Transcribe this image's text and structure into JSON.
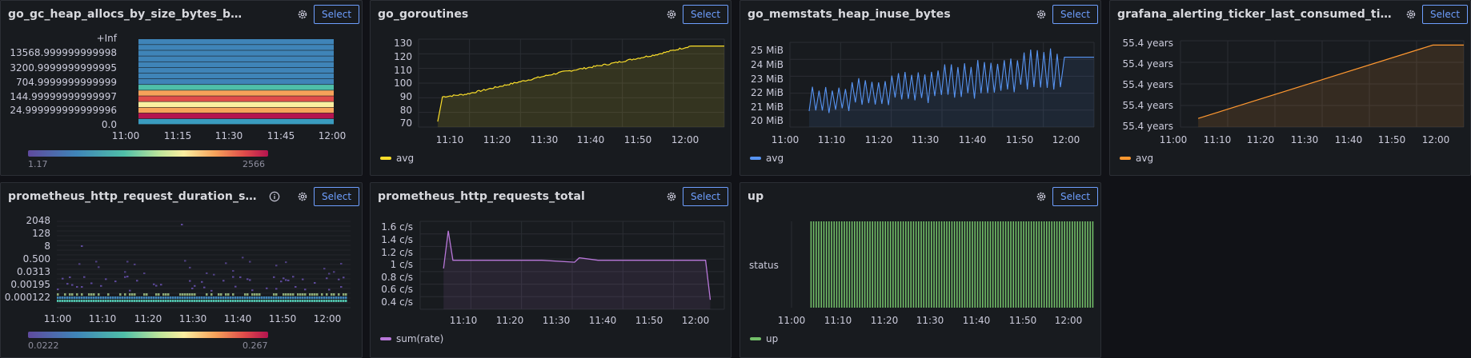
{
  "select_label": "Select",
  "x_ticks": [
    "11:00",
    "11:10",
    "11:20",
    "11:30",
    "11:40",
    "11:50",
    "12:00"
  ],
  "x_ticks_heap": [
    "11:00",
    "11:15",
    "11:30",
    "11:45",
    "12:00"
  ],
  "panels": {
    "heap_allocs": {
      "title": "go_gc_heap_allocs_by_size_bytes_bucket",
      "y_ticks": [
        "+Inf",
        "13568.999999999998",
        "3200.9999999999995",
        "704.9999999999999",
        "144.99999999999997",
        "24.999999999999996",
        "0.0"
      ],
      "scale_min": "1.17",
      "scale_max": "2566"
    },
    "goroutines": {
      "title": "go_goroutines",
      "y_ticks": [
        "130",
        "120",
        "110",
        "100",
        "90",
        "80",
        "70"
      ],
      "legend": "avg",
      "color": "#fade2a"
    },
    "memstats": {
      "title": "go_memstats_heap_inuse_bytes",
      "y_ticks": [
        "25 MiB",
        "24 MiB",
        "23 MiB",
        "22 MiB",
        "21 MiB",
        "20 MiB"
      ],
      "legend": "avg",
      "color": "#5794f2"
    },
    "ticker": {
      "title": "grafana_alerting_ticker_last_consumed_tick_t...",
      "y_ticks": [
        "55.4 years",
        "55.4 years",
        "55.4 years",
        "55.4 years",
        "55.4 years"
      ],
      "legend": "avg",
      "color": "#ff9830"
    },
    "duration": {
      "title": "prometheus_http_request_duration_seco...",
      "y_ticks": [
        "2048",
        "128",
        "8",
        "0.500",
        "0.0313",
        "0.00195",
        "0.000122"
      ],
      "scale_min": "0.0222",
      "scale_max": "0.267"
    },
    "requests": {
      "title": "prometheus_http_requests_total",
      "y_ticks": [
        "1.6 c/s",
        "1.4 c/s",
        "1.2 c/s",
        "1 c/s",
        "0.8 c/s",
        "0.6 c/s",
        "0.4 c/s"
      ],
      "legend": "sum(rate)",
      "color": "#b877d9"
    },
    "up": {
      "title": "up",
      "y_label": "status",
      "legend": "up",
      "color": "#73bf69"
    }
  },
  "chart_data": [
    {
      "type": "heatmap",
      "title": "go_gc_heap_allocs_by_size_bytes_bucket",
      "x": [
        "11:00",
        "11:15",
        "11:30",
        "11:45",
        "12:00"
      ],
      "y_buckets": [
        "0.0",
        "24.999999999999996",
        "144.99999999999997",
        "704.9999999999999",
        "3200.9999999999995",
        "13568.999999999998",
        "+Inf"
      ],
      "row_intensity": [
        0.25,
        0.95,
        0.7,
        0.85,
        0.75,
        0.3,
        0.1,
        0.05,
        0.05,
        0.05,
        0.05,
        0.05,
        0.05,
        0.05,
        0.05
      ],
      "color_range": [
        1.17,
        2566
      ]
    },
    {
      "type": "line",
      "title": "go_goroutines",
      "series": [
        {
          "name": "avg",
          "x": [
            "11:04",
            "11:05",
            "11:10",
            "11:20",
            "11:30",
            "11:40",
            "11:50",
            "11:57",
            "12:04"
          ],
          "values": [
            72,
            90,
            92,
            100,
            108,
            114,
            121,
            127,
            127
          ]
        }
      ],
      "ylim": [
        68,
        132
      ]
    },
    {
      "type": "line",
      "title": "go_memstats_heap_inuse_bytes",
      "series": [
        {
          "name": "avg",
          "unit": "MiB",
          "low": [
            20.6,
            21.0,
            21.3,
            21.6,
            21.9,
            22.2
          ],
          "high": [
            22.6,
            23.2,
            23.6,
            24.0,
            24.4,
            25.0
          ],
          "tail": 24.4
        }
      ],
      "ylim": [
        19.7,
        25.4
      ]
    },
    {
      "type": "line",
      "title": "grafana_alerting_ticker_last_consumed_tick_t...",
      "series": [
        {
          "name": "avg",
          "x": [
            "11:04",
            "11:57",
            "12:04"
          ],
          "values": [
            0.1,
            0.95,
            0.95
          ]
        }
      ]
    },
    {
      "type": "heatmap",
      "title": "prometheus_http_request_duration_seco...",
      "y_buckets": [
        "0.000122",
        "0.00195",
        "0.0313",
        "0.500",
        "8",
        "128",
        "2048"
      ],
      "color_range": [
        0.0222,
        0.267
      ]
    },
    {
      "type": "line",
      "title": "prometheus_http_requests_total",
      "series": [
        {
          "name": "sum(rate)",
          "unit": "c/s",
          "x": [
            "11:04",
            "11:05",
            "11:06",
            "11:25",
            "11:32",
            "11:33",
            "11:37",
            "11:50",
            "12:00",
            "12:01"
          ],
          "values": [
            0.95,
            1.55,
            1.08,
            1.08,
            1.05,
            1.12,
            1.08,
            1.08,
            1.08,
            0.45
          ]
        }
      ],
      "ylim": [
        0.3,
        1.7
      ]
    },
    {
      "type": "bar",
      "title": "up",
      "series": [
        {
          "name": "up",
          "values": [
            1
          ]
        }
      ],
      "x_range": [
        "11:04",
        "12:04"
      ]
    }
  ]
}
